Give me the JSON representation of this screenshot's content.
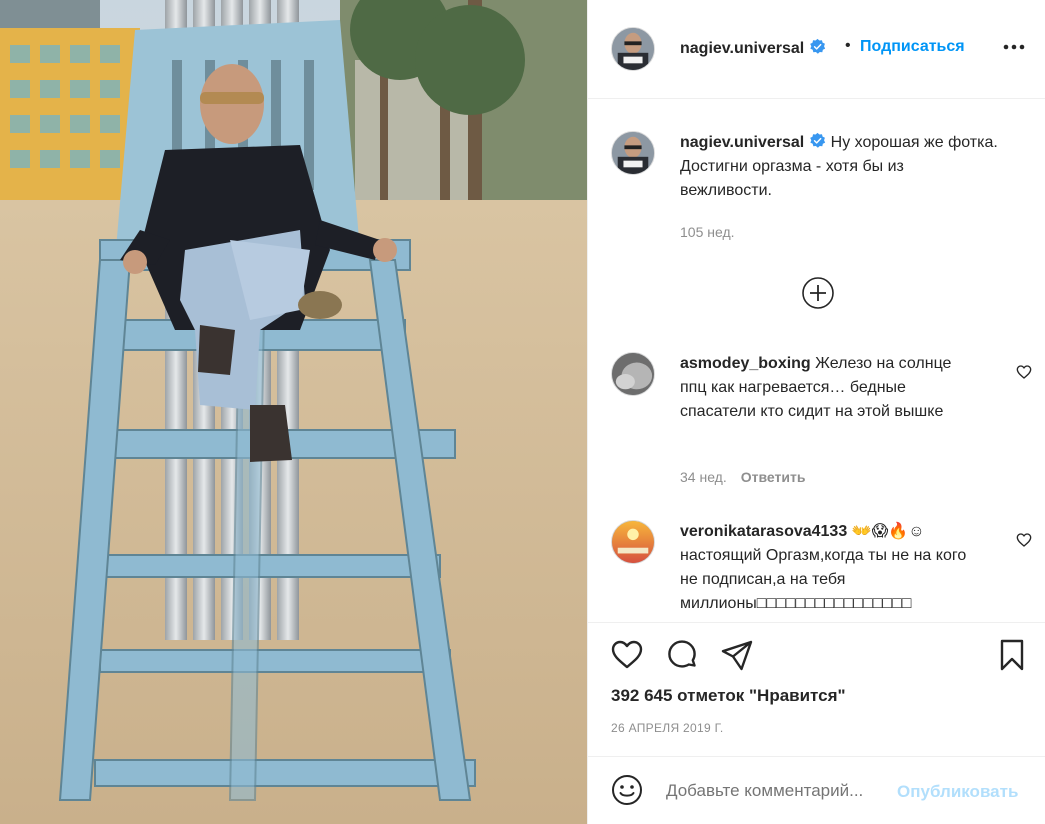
{
  "post": {
    "username": "nagiev.universal",
    "dot": "•",
    "follow_label": "Подписаться",
    "more_icon": "more-horizontal-icon",
    "avatar_text": "nagiev.universal"
  },
  "caption": {
    "username": "nagiev.universal",
    "text": "Ну хорошая же фотка. Достигни оргазма - хотя бы из вежливости.",
    "time": "105 нед."
  },
  "load_more_icon": "plus-circle-icon",
  "comments": [
    {
      "username": "asmodey_boxing",
      "text": "Железо на солнце ппц как нагревается… бедные спасатели кто сидит на этой вышке",
      "time": "34 нед.",
      "reply_label": "Ответить"
    },
    {
      "username": "veronikatarasova4133",
      "emoji": "👐😱🔥☺",
      "text": "настоящий Оргазм,когда ты не на кого не подписан,а на тебя миллионы□□□□□□□□□□□□□□□□"
    }
  ],
  "actions": {
    "icons": [
      "heart-icon",
      "comment-icon",
      "share-icon",
      "bookmark-icon"
    ],
    "likes_text": "392 645 отметок \"Нравится\"",
    "date": "26 АПРЕЛЯ 2019 Г."
  },
  "add_comment": {
    "placeholder": "Добавьте комментарий...",
    "post_label": "Опубликовать"
  },
  "colors": {
    "accent": "#0095f6",
    "post_disabled": "#b2dffc",
    "muted": "#8e8e8e",
    "verified": "#3897f0"
  }
}
